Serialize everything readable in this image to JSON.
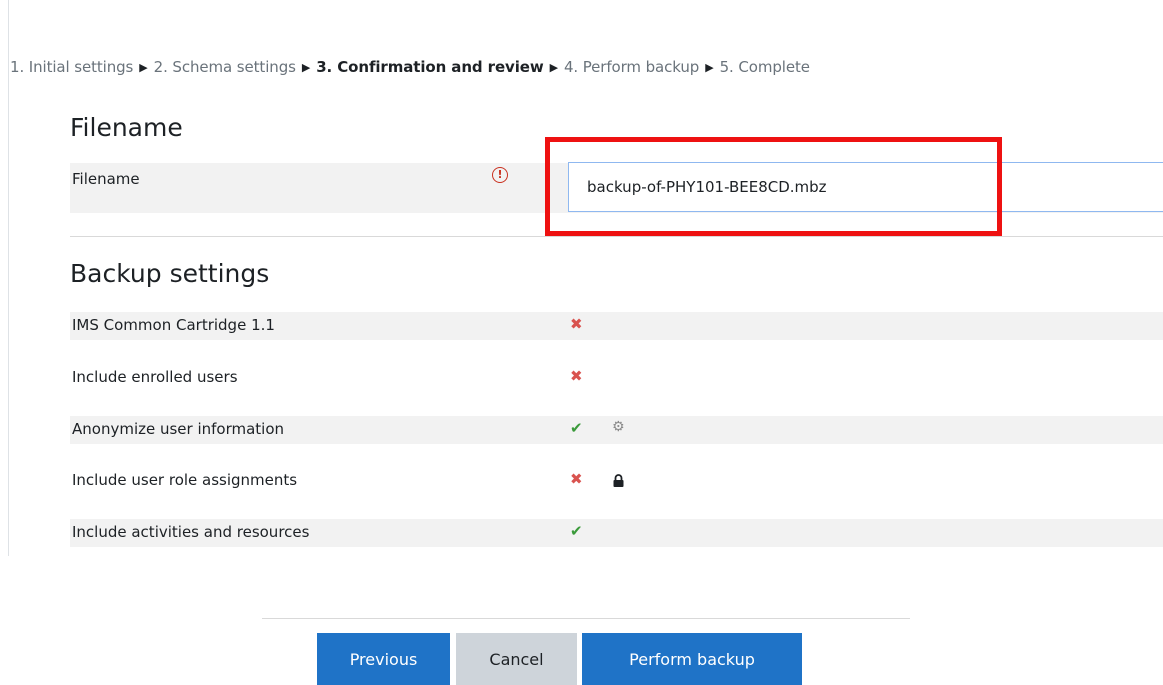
{
  "progress": {
    "steps": [
      "1. Initial settings",
      "2. Schema settings",
      "3. Confirmation and review",
      "4. Perform backup",
      "5. Complete"
    ],
    "separator": "▶",
    "current_index": 2
  },
  "filename_section": {
    "heading": "Filename",
    "label": "Filename",
    "required_icon": "exclamation-circle-icon",
    "value": "backup-of-PHY101-BEE8CD.mbz"
  },
  "backup_settings": {
    "heading": "Backup settings",
    "rows": [
      {
        "label": "IMS Common Cartridge 1.1",
        "status": "no",
        "status_glyph": "✖",
        "extra_icon": ""
      },
      {
        "label": "Include enrolled users",
        "status": "no",
        "status_glyph": "✖",
        "extra_icon": ""
      },
      {
        "label": "Anonymize user information",
        "status": "yes",
        "status_glyph": "✔",
        "extra_icon": "gears-icon"
      },
      {
        "label": "Include user role assignments",
        "status": "no",
        "status_glyph": "✖",
        "extra_icon": "lock-icon"
      },
      {
        "label": "Include activities and resources",
        "status": "yes",
        "status_glyph": "✔",
        "extra_icon": ""
      }
    ]
  },
  "buttons": {
    "previous": "Previous",
    "cancel": "Cancel",
    "perform": "Perform backup"
  },
  "colors": {
    "primary": "#1f73c7",
    "secondary": "#ced4da",
    "no": "#d9534f",
    "yes": "#3a9a3a",
    "highlight": "#ee1111"
  }
}
